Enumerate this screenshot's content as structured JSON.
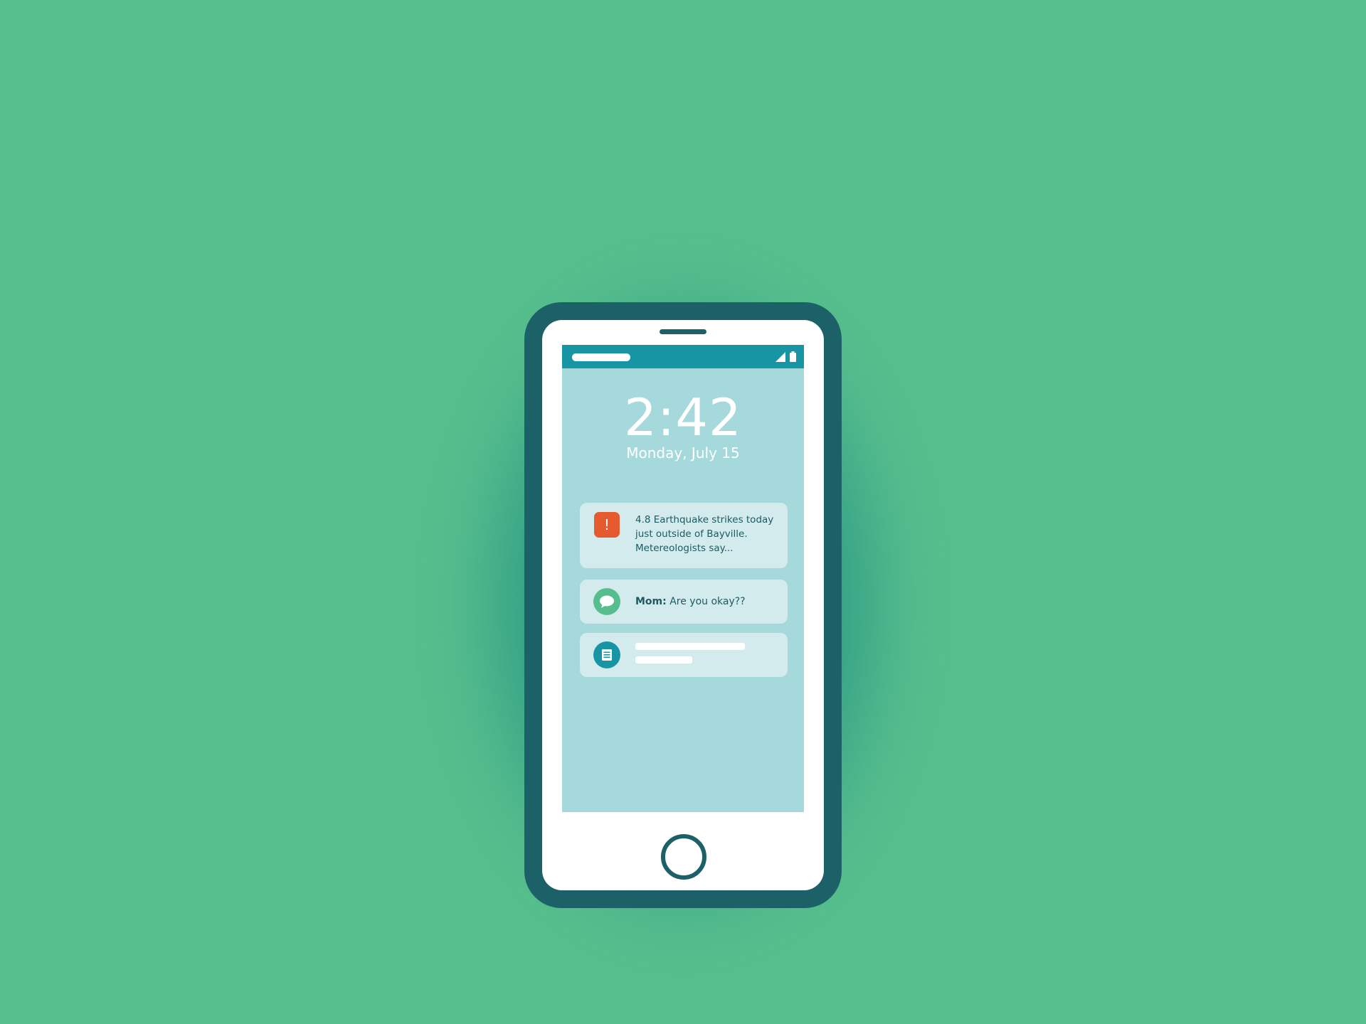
{
  "lock_screen": {
    "time": "2:42",
    "date": "Monday, July 15"
  },
  "notifications": [
    {
      "type": "alert",
      "icon": "alert-exclamation-icon",
      "icon_glyph": "!",
      "icon_color": "#e65a2f",
      "text": "4.8 Earthquake strikes today just outside of Bayville. Metereologists say..."
    },
    {
      "type": "message",
      "icon": "chat-bubble-icon",
      "icon_color": "#56be8d",
      "sender": "Mom:",
      "text": " Are you okay??"
    },
    {
      "type": "document",
      "icon": "document-icon",
      "icon_color": "#1895a5"
    }
  ],
  "colors": {
    "background": "#56be8d",
    "phone_body": "#1d6168",
    "screen": "#a6d9dc",
    "status_bar": "#1895a5",
    "card": "#d3ebec",
    "text_dark": "#1d5a63"
  }
}
